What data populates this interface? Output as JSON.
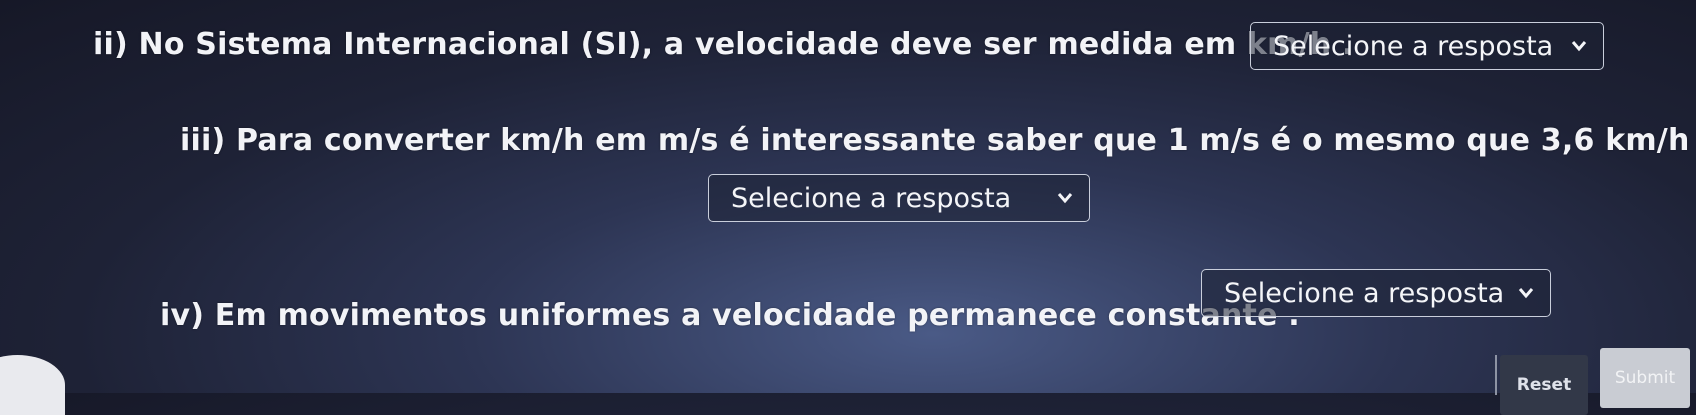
{
  "questions": [
    {
      "text": "ii) No Sistema Internacional (SI), a velocidade deve ser medida em km/h .",
      "select_value": "Selecione a resposta"
    },
    {
      "text": "iii) Para converter km/h em m/s é interessante saber que 1 m/s é o mesmo que 3,6 km/h .",
      "select_value": "Selecione a resposta"
    },
    {
      "text": "iv) Em movimentos uniformes a velocidade permanece constante .",
      "select_value": "Selecione a resposta"
    }
  ],
  "buttons": {
    "reset": "Reset",
    "submit": "Submit"
  },
  "icons": {
    "dropdown": "chevron-down-icon"
  }
}
